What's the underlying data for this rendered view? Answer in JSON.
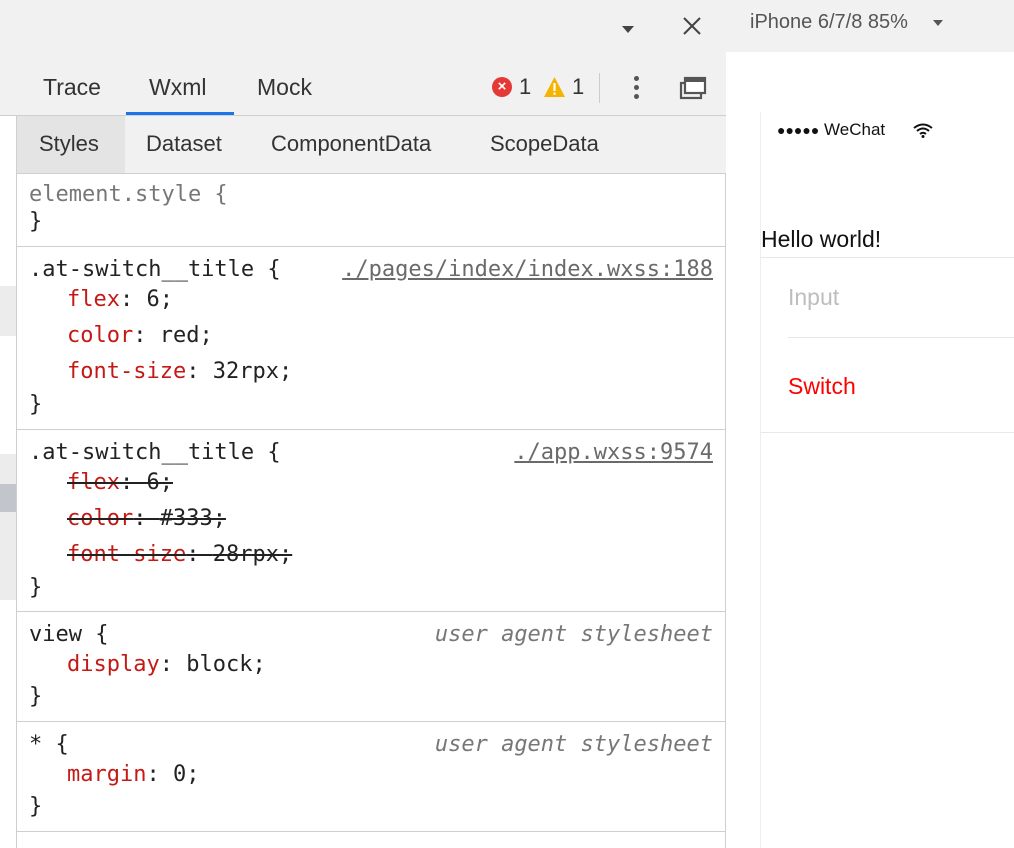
{
  "devtools": {
    "tabs": [
      {
        "label": "Trace"
      },
      {
        "label": "Wxml"
      },
      {
        "label": "Mock"
      }
    ],
    "active_tab": "Wxml",
    "error_count": "1",
    "warning_count": "1",
    "subtabs": [
      {
        "label": "Styles"
      },
      {
        "label": "Dataset"
      },
      {
        "label": "ComponentData"
      },
      {
        "label": "ScopeData"
      }
    ],
    "active_subtab": "Styles",
    "rules": {
      "element_style": {
        "selector": "element.style {",
        "close": "}"
      },
      "rule1": {
        "selector": ".at-switch__title {",
        "source": "./pages/index/index.wxss:188",
        "decls": [
          {
            "prop": "flex",
            "value": "6;"
          },
          {
            "prop": "color",
            "value": "red;"
          },
          {
            "prop": "font-size",
            "value": "32rpx;"
          }
        ],
        "close": "}"
      },
      "rule2": {
        "selector": ".at-switch__title {",
        "source": "./app.wxss:9574",
        "decls": [
          {
            "prop": "flex",
            "value": "6;"
          },
          {
            "prop": "color",
            "value": "#333;"
          },
          {
            "prop": "font-size",
            "value": "28rpx;"
          }
        ],
        "close": "}"
      },
      "rule3": {
        "selector": "view {",
        "source": "user agent stylesheet",
        "decls": [
          {
            "prop": "display",
            "value": "block;"
          }
        ],
        "close": "}"
      },
      "rule4": {
        "selector": "* {",
        "source": "user agent stylesheet",
        "decls": [
          {
            "prop": "margin",
            "value": "0;"
          }
        ],
        "close": "}"
      }
    },
    "colors": {
      "accent": "#1a73e8",
      "property": "#c41a16",
      "error": "#e53935",
      "warning": "#f5b400"
    },
    "icons": [
      "dropdown-arrow-icon",
      "close-icon",
      "error-icon",
      "warning-icon",
      "more-vertical-icon",
      "undock-icon"
    ]
  },
  "simulator": {
    "device": "iPhone 6/7/8 85%",
    "status_dots": "●●●●●",
    "status_carrier": "WeChat",
    "hello_text": "Hello world!",
    "input_placeholder": "Input",
    "switch_title": "Switch",
    "switch_color": "#ff0000"
  }
}
